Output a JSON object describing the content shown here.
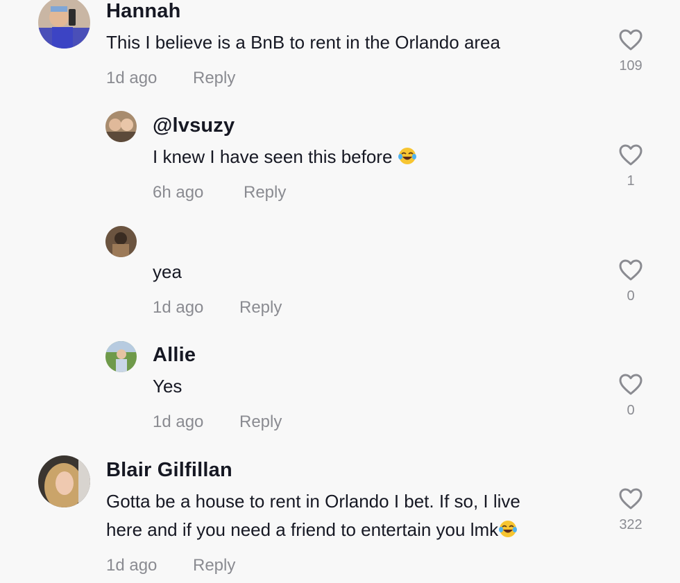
{
  "comments": [
    {
      "name": "Hannah",
      "text_lines": [
        "This I believe is a BnB to rent in the Orlando area"
      ],
      "time": "1d ago",
      "reply_label": "Reply",
      "likes": "109",
      "avatar_icon": "user-avatar-photo"
    },
    {
      "name": "@lvsuzy",
      "text_lines": [
        "I knew I have seen this before"
      ],
      "emoji": "face-with-tears-of-joy",
      "time": "6h ago",
      "reply_label": "Reply",
      "likes": "1",
      "avatar_icon": "user-avatar-photo"
    },
    {
      "name": "",
      "text_lines": [
        "yea"
      ],
      "time": "1d ago",
      "reply_label": "Reply",
      "likes": "0",
      "avatar_icon": "user-avatar-photo"
    },
    {
      "name": "Allie",
      "text_lines": [
        "Yes"
      ],
      "time": "1d ago",
      "reply_label": "Reply",
      "likes": "0",
      "avatar_icon": "user-avatar-photo"
    },
    {
      "name": "Blair Gilfillan",
      "text_lines": [
        "Gotta be a house to rent in Orlando I bet. If so, I live",
        "here and if you need a friend to entertain you lmk"
      ],
      "emoji": "face-with-tears-of-joy",
      "time": "1d ago",
      "reply_label": "Reply",
      "likes": "322",
      "avatar_icon": "user-avatar-photo"
    }
  ],
  "icons": {
    "like": "heart-outline-icon"
  },
  "colors": {
    "text": "#161823",
    "muted": "#8a8b91",
    "background": "#f8f8f8"
  }
}
